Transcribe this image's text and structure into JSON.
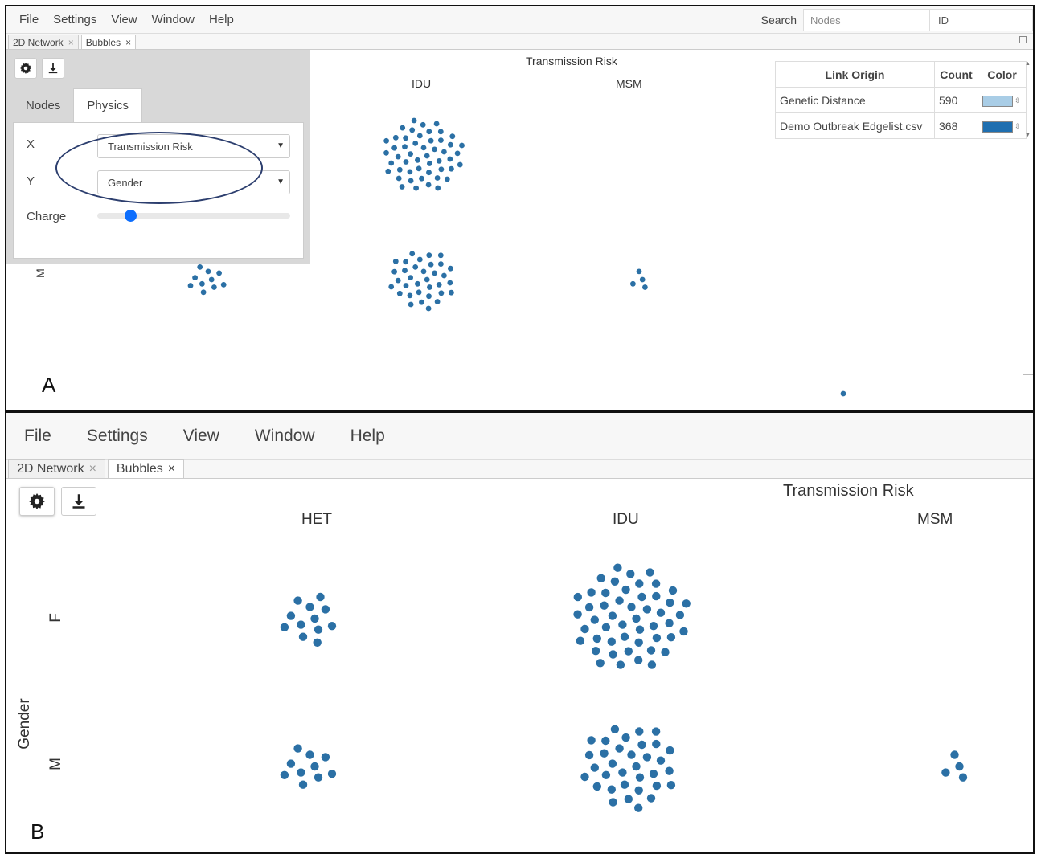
{
  "colors": {
    "node": "#2b70a5",
    "genetic_distance": "#a9cde6",
    "edgelist": "#1f6fb0",
    "slider": "#0d6efd",
    "oval": "#2c3e6e"
  },
  "icons": {
    "settings": "gear-icon",
    "export": "download-icon",
    "close": "close-icon",
    "caret": "caret-down-icon",
    "maximize": "maximize-icon"
  },
  "menu": [
    "File",
    "Settings",
    "View",
    "Window",
    "Help"
  ],
  "tabs": [
    {
      "label": "2D Network",
      "close": "×"
    },
    {
      "label": "Bubbles",
      "close": "×"
    }
  ],
  "panel_a": {
    "letter": "A",
    "search": {
      "label": "Search",
      "placeholder": "Nodes",
      "field": "ID"
    },
    "subtabs": [
      "Nodes",
      "Physics"
    ],
    "settings": {
      "x_label": "X",
      "x_value": "Transmission Risk",
      "y_label": "Y",
      "y_value": "Gender",
      "charge_label": "Charge",
      "charge_level": 0.17
    },
    "legend": {
      "headers": [
        "Link Origin",
        "Count",
        "Color"
      ],
      "rows": [
        {
          "origin": "Genetic Distance",
          "count": "590"
        },
        {
          "origin": "Demo Outbreak Edgelist.csv",
          "count": "368"
        }
      ]
    },
    "x_title": "Transmission Risk",
    "x_categories": [
      "IDU",
      "MSM"
    ],
    "y_categories": [
      "M"
    ]
  },
  "panel_b": {
    "letter": "B",
    "x_title": "Transmission Risk",
    "x_categories": [
      "HET",
      "IDU",
      "MSM"
    ],
    "y_title": "Gender",
    "y_categories": [
      "F",
      "M"
    ]
  },
  "chart_data": {
    "type": "scatter",
    "title": "",
    "xlabel": "Transmission Risk",
    "ylabel": "Gender",
    "categories_x": [
      "HET",
      "IDU",
      "MSM"
    ],
    "categories_y": [
      "F",
      "M"
    ],
    "clusters": [
      {
        "x": "HET",
        "y": "F",
        "nodes": 12
      },
      {
        "x": "IDU",
        "y": "F",
        "nodes": 50
      },
      {
        "x": "HET",
        "y": "M",
        "nodes": 10
      },
      {
        "x": "IDU",
        "y": "M",
        "nodes": 34
      },
      {
        "x": "MSM",
        "y": "M",
        "nodes": 4
      }
    ]
  }
}
